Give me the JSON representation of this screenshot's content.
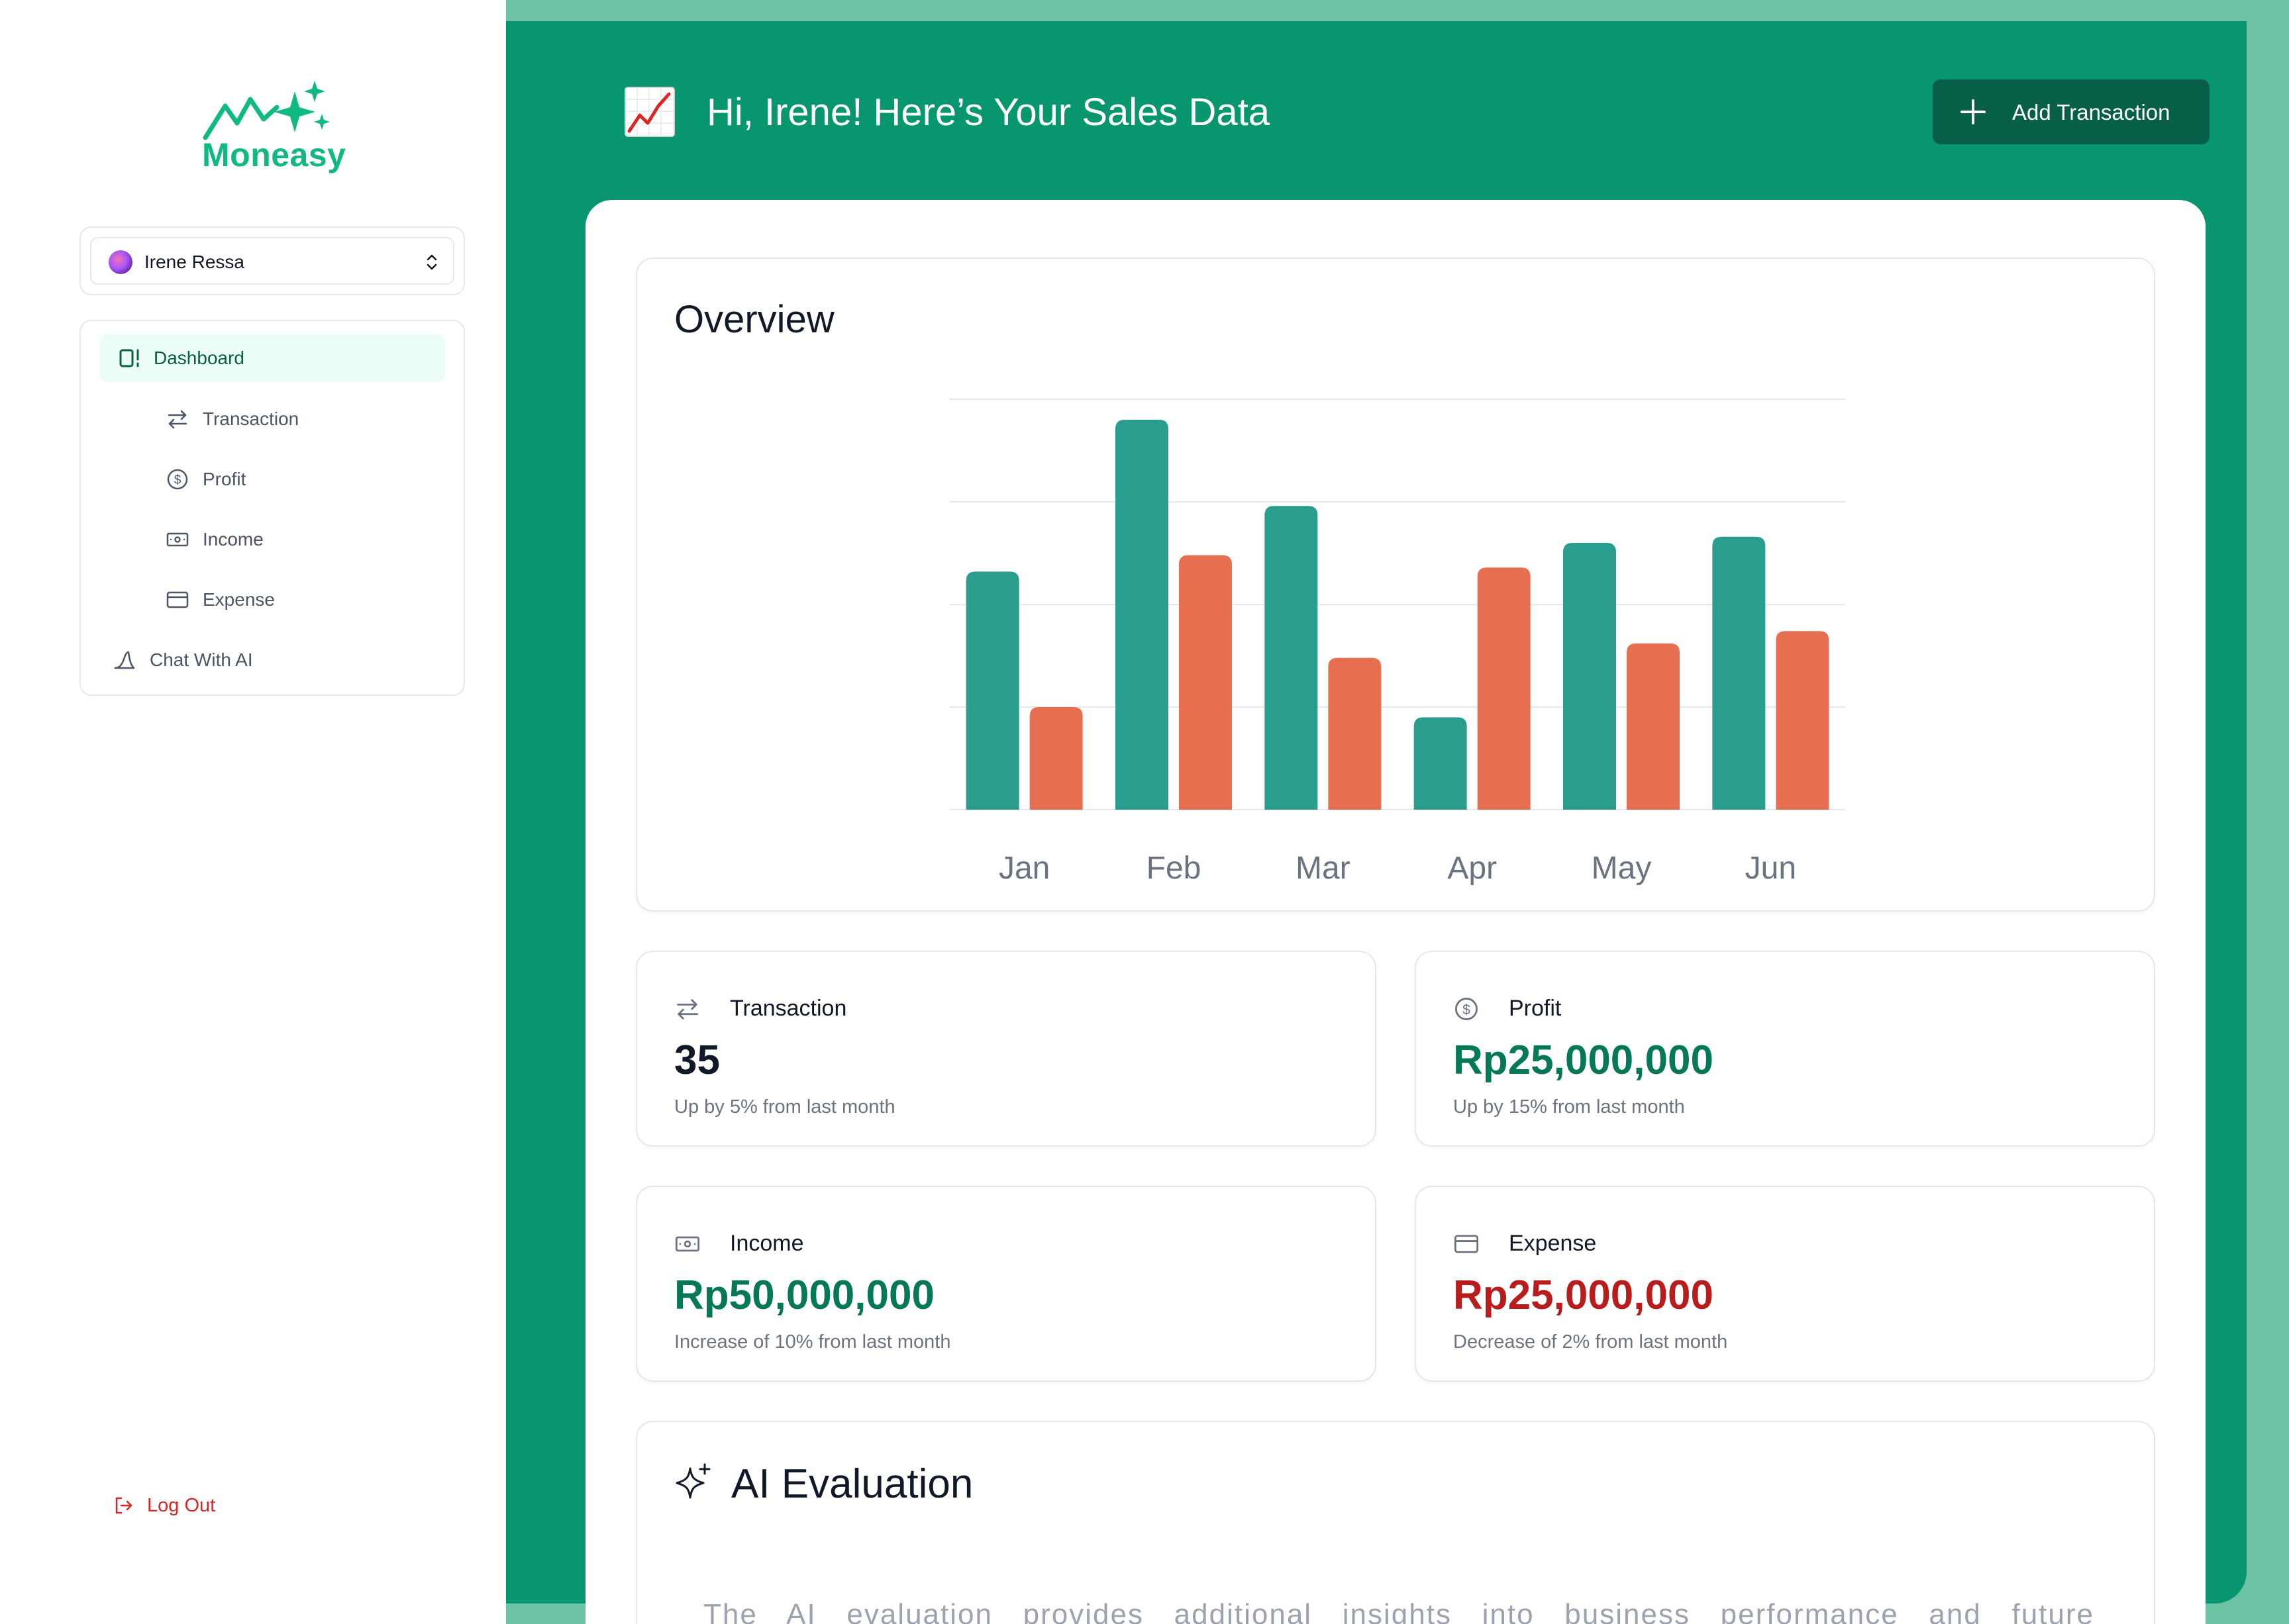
{
  "app": {
    "brand_name": "Moneasy",
    "brand_color": "#10b981",
    "accent_dark": "#065f46",
    "panel_green": "#07966d"
  },
  "user": {
    "name": "Irene Ressa"
  },
  "sidebar": {
    "items": [
      {
        "label": "Dashboard",
        "icon": "dashboard-icon",
        "active": true
      },
      {
        "label": "Transaction",
        "icon": "arrows-exchange-icon"
      },
      {
        "label": "Profit",
        "icon": "dollar-circle-icon"
      },
      {
        "label": "Income",
        "icon": "banknote-icon"
      },
      {
        "label": "Expense",
        "icon": "credit-card-icon"
      },
      {
        "label": "Chat With AI",
        "icon": "ai-chat-icon"
      }
    ],
    "logout_label": "Log Out"
  },
  "header": {
    "title": "Hi, Irene! Here’s Your Sales Data",
    "add_button_label": "Add Transaction"
  },
  "overview": {
    "title": "Overview"
  },
  "chart_data": {
    "type": "bar",
    "title": "Overview",
    "categories": [
      "Jan",
      "Feb",
      "Mar",
      "Apr",
      "May",
      "Jun"
    ],
    "series": [
      {
        "values": [
          116,
          190,
          148,
          45,
          130,
          133
        ],
        "color": "#2a9d8f"
      },
      {
        "values": [
          50,
          124,
          74,
          118,
          81,
          87
        ],
        "color": "#e76f51"
      }
    ],
    "ylim": [
      0,
      200
    ],
    "grid": true
  },
  "stats": [
    {
      "title": "Transaction",
      "value": "35",
      "sub": "Up by 5% from last month",
      "icon": "arrows-exchange-icon",
      "value_color": "#111827"
    },
    {
      "title": "Profit",
      "value": "Rp25,000,000",
      "sub": "Up by 15% from last month",
      "icon": "dollar-circle-icon",
      "value_color": "#047857"
    },
    {
      "title": "Income",
      "value": "Rp50,000,000",
      "sub": "Increase of 10% from last month",
      "icon": "banknote-icon",
      "value_color": "#047857"
    },
    {
      "title": "Expense",
      "value": "Rp25,000,000",
      "sub": "Decrease of 2% from last month",
      "icon": "credit-card-icon",
      "value_color": "#b91c1c"
    }
  ],
  "ai": {
    "title": "AI Evaluation",
    "text": "The AI evaluation provides additional insights into business performance and future"
  }
}
